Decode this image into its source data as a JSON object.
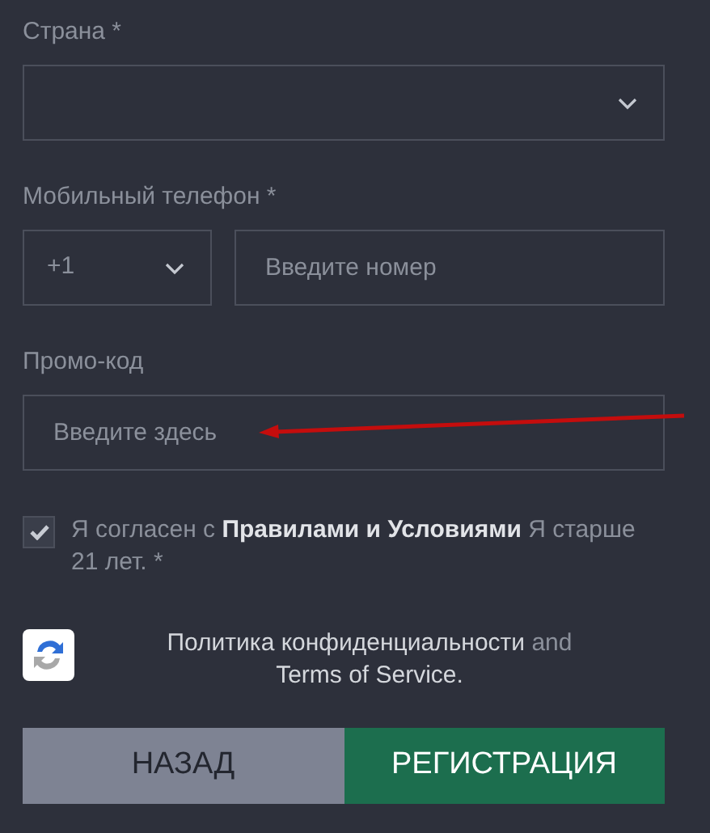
{
  "country": {
    "label": "Страна *"
  },
  "phone": {
    "label": "Мобильный телефон *",
    "code": "+1",
    "placeholder": "Введите номер"
  },
  "promo": {
    "label": "Промо-код",
    "placeholder": "Введите здесь"
  },
  "agreement": {
    "checked": true,
    "text": "Я согласен с **Правилами и Условиями** Я старше 21 лет. *"
  },
  "recaptcha": {
    "privacy": "Политика конфиденциальности",
    "and": "and",
    "terms": "Terms of Service."
  },
  "buttons": [
    {
      "kind": "secondary",
      "label": "НАЗАД"
    },
    {
      "kind": "primary",
      "label": "РЕГИСТРАЦИЯ"
    }
  ]
}
